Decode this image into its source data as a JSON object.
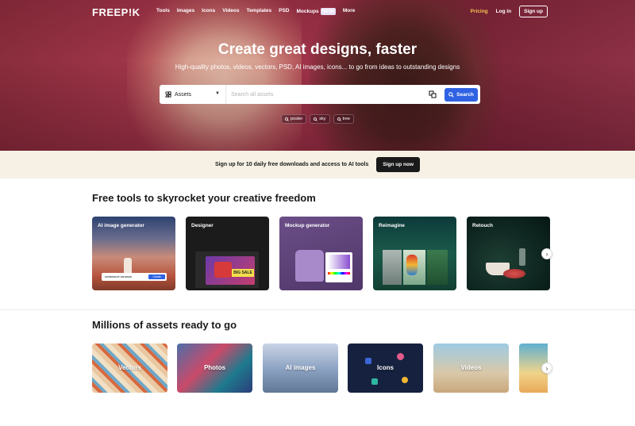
{
  "nav": {
    "logo": "FREEP!K",
    "links": [
      "Tools",
      "Images",
      "Icons",
      "Videos",
      "Templates",
      "PSD",
      "Mockups",
      "More"
    ],
    "new_badge": "NEW",
    "pricing": "Pricing",
    "login": "Log in",
    "signup": "Sign up"
  },
  "hero": {
    "title": "Create great designs, faster",
    "subtitle": "High-quality photos, videos, vectors, PSD, AI images, icons... to go from ideas to outstanding designs",
    "search": {
      "category": "Assets",
      "placeholder": "Search all assets",
      "button": "Search"
    },
    "chips": [
      "poster",
      "sky",
      "tree"
    ]
  },
  "banner": {
    "text": "Sign up for 10 daily free downloads and access to AI tools",
    "button": "Sign up now"
  },
  "tools_section": {
    "title": "Free tools to skyrocket your creative freedom",
    "cards": [
      {
        "label": "AI image generator",
        "inner": "ASTRONAUT ON MARS",
        "inner_btn": "Create"
      },
      {
        "label": "Designer",
        "inner": "BIG SALE"
      },
      {
        "label": "Mockup generator"
      },
      {
        "label": "Reimagine"
      },
      {
        "label": "Retouch"
      }
    ]
  },
  "assets_section": {
    "title": "Millions of assets ready to go",
    "cards": [
      "Vectors",
      "Photos",
      "AI images",
      "Icons",
      "Videos",
      ""
    ]
  },
  "colors": {
    "accent": "#2f62e3",
    "pricing": "#f6c453",
    "banner_bg": "#f6f1e4"
  }
}
